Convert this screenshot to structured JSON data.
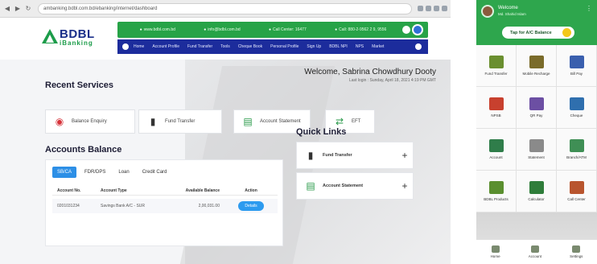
{
  "browser": {
    "url": "ambanking.bdbl.com.bd/ebanking/internet/dashboard"
  },
  "logo": {
    "brand": "BDBL",
    "sub": "iBanking"
  },
  "topbar": {
    "items": [
      "www.bdbl.com.bd",
      "info@bdbl.com.bd",
      "Call Center: 16477",
      "Call: 880-2-9562 2 9, 9556"
    ]
  },
  "navbar": {
    "items": [
      "Home",
      "Account Profile",
      "Fund Transfer",
      "Tools",
      "Cheque Book",
      "Personal Profile",
      "Sign Up",
      "BDBL NPI",
      "NPS",
      "Market"
    ]
  },
  "welcome": {
    "name": "Welcome, Sabrina Chowdhury Dooty",
    "last_login": "Last login : Sunday, April 18, 2021 4:19 PM GMT"
  },
  "recent_services": {
    "title": "Recent Services",
    "items": [
      {
        "label": "Balance Enquiry",
        "icon": "balance-enquiry-icon"
      },
      {
        "label": "Fund Transfer",
        "icon": "fund-transfer-icon"
      },
      {
        "label": "Account Statement",
        "icon": "account-statement-icon"
      },
      {
        "label": "EFT",
        "icon": "eft-icon"
      }
    ]
  },
  "accounts": {
    "title": "Accounts Balance",
    "tabs": [
      "SB/CA",
      "FDR/DPS",
      "Loan",
      "Credit Card"
    ],
    "active_tab": "SB/CA",
    "headers": [
      "Account No.",
      "Account Type",
      "Available Balance",
      "Action"
    ],
    "rows": [
      {
        "account_no": "0201031234",
        "type": "Savings Bank A/C - SUR",
        "balance": "2,00,031.00",
        "action": "Details"
      }
    ]
  },
  "quick_links": {
    "title": "Quick Links",
    "items": [
      {
        "label": "Fund Transfer",
        "icon": "fund-transfer-icon"
      },
      {
        "label": "Account Statement",
        "icon": "account-statement-icon"
      }
    ]
  },
  "mobile": {
    "user_name": "Welcome",
    "user_id": "Md. Shahid Islam",
    "tap_button": "Tap for A/C Balance",
    "grid": [
      {
        "label": "Fund Transfer",
        "icon": "fund-transfer-icon",
        "color": "#6a8f2f"
      },
      {
        "label": "Mobile Recharge",
        "icon": "mobile-recharge-icon",
        "color": "#7a6b2a"
      },
      {
        "label": "Bill Pay",
        "icon": "bill-pay-icon",
        "color": "#3a5fae"
      },
      {
        "label": "NPSB",
        "icon": "npsb-icon",
        "color": "#c8402e"
      },
      {
        "label": "QR Pay",
        "icon": "qr-pay-icon",
        "color": "#6c4fa3"
      },
      {
        "label": "Cheque",
        "icon": "cheque-icon",
        "color": "#2f6fae"
      },
      {
        "label": "Account",
        "icon": "account-icon",
        "color": "#2f7d4a"
      },
      {
        "label": "Statement",
        "icon": "statement-icon",
        "color": "#8a8a8a"
      },
      {
        "label": "Branch/ATM",
        "icon": "branch-atm-icon",
        "color": "#3f8f55"
      },
      {
        "label": "BDBL Products",
        "icon": "products-icon",
        "color": "#5a8f2f"
      },
      {
        "label": "Calculator",
        "icon": "calculator-icon",
        "color": "#2f7d3a"
      },
      {
        "label": "Call Center",
        "icon": "call-center-icon",
        "color": "#b8552e"
      }
    ],
    "bottom_nav": [
      "Home",
      "Account",
      "Settings"
    ]
  }
}
